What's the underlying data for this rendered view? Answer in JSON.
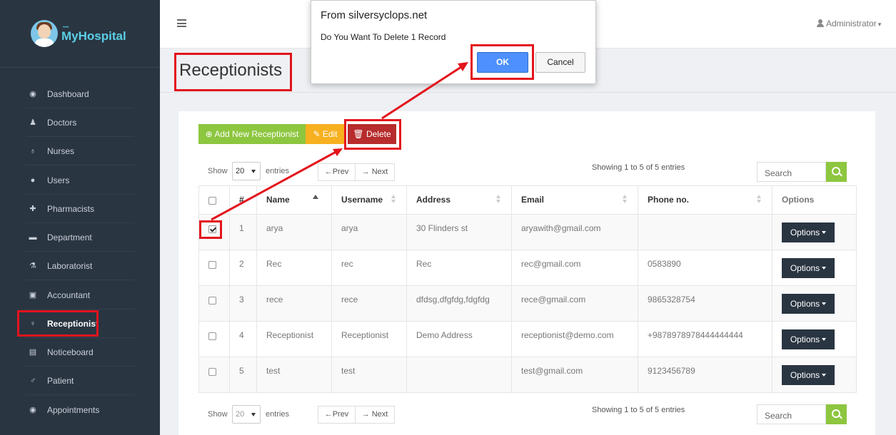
{
  "brand": {
    "name": "MyHospital",
    "tagline": "••••"
  },
  "sidebar": {
    "items": [
      {
        "label": "Dashboard",
        "icon": "dashboard-icon",
        "glyph": "◉"
      },
      {
        "label": "Doctors",
        "icon": "doctor-icon",
        "glyph": "♟"
      },
      {
        "label": "Nurses",
        "icon": "stethoscope-icon",
        "glyph": "♁"
      },
      {
        "label": "Users",
        "icon": "user-icon",
        "glyph": "●"
      },
      {
        "label": "Pharmacists",
        "icon": "plus-square-icon",
        "glyph": "✚"
      },
      {
        "label": "Department",
        "icon": "briefcase-icon",
        "glyph": "▬"
      },
      {
        "label": "Laboratorist",
        "icon": "flask-icon",
        "glyph": "⚗"
      },
      {
        "label": "Accountant",
        "icon": "money-icon",
        "glyph": "▣"
      },
      {
        "label": "Receptionist",
        "icon": "female-icon",
        "glyph": "♀",
        "active": true
      },
      {
        "label": "Noticeboard",
        "icon": "file-icon",
        "glyph": "▤"
      },
      {
        "label": "Patient",
        "icon": "male-icon",
        "glyph": "♂"
      },
      {
        "label": "Appointments",
        "icon": "dashboard-icon",
        "glyph": "◉"
      }
    ]
  },
  "topbar": {
    "user": "Administrator"
  },
  "page": {
    "title": "Receptionists"
  },
  "toolbar": {
    "add_label": "Add New Receptionist",
    "edit_label": "Edit",
    "delete_label": "Delete"
  },
  "datatable": {
    "show_label": "Show",
    "entries_label": "entries",
    "page_size": "20",
    "prev_label": "←Prev",
    "next_label": "→ Next",
    "info": "Showing 1 to 5 of 5 entries",
    "search_placeholder": "Search"
  },
  "table": {
    "columns": [
      "#",
      "Name",
      "Username",
      "Address",
      "Email",
      "Phone no.",
      "Options"
    ],
    "rows": [
      {
        "num": "1",
        "name": "arya",
        "username": "arya",
        "address": "30 Flinders st",
        "email": "aryawith@gmail.com",
        "phone": "",
        "checked": true
      },
      {
        "num": "2",
        "name": "Rec",
        "username": "rec",
        "address": "Rec",
        "email": "rec@gmail.com",
        "phone": "0583890",
        "checked": false
      },
      {
        "num": "3",
        "name": "rece",
        "username": "rece",
        "address": "dfdsg,dfgfdg,fdgfdg",
        "email": "rece@gmail.com",
        "phone": "9865328754",
        "checked": false
      },
      {
        "num": "4",
        "name": "Receptionist",
        "username": "Receptionist",
        "address": "Demo Address",
        "email": "receptionist@demo.com",
        "phone": "+9878978978444444444",
        "checked": false
      },
      {
        "num": "5",
        "name": "test",
        "username": "test",
        "address": "",
        "email": "test@gmail.com",
        "phone": "9123456789",
        "checked": false
      }
    ],
    "options_label": "Options"
  },
  "dialog": {
    "title": "From silversyclops.net",
    "message": "Do You Want To Delete 1 Record",
    "ok_label": "OK",
    "cancel_label": "Cancel"
  },
  "colors": {
    "sidebar_bg": "#2a3542",
    "brand_text": "#5ad0e5",
    "add_button": "#8dc63f",
    "edit_button": "#f7b020",
    "delete_button": "#b72c2c",
    "options_button": "#2a3542",
    "dialog_ok": "#4d90fe",
    "annotation_red": "#e3141c"
  }
}
